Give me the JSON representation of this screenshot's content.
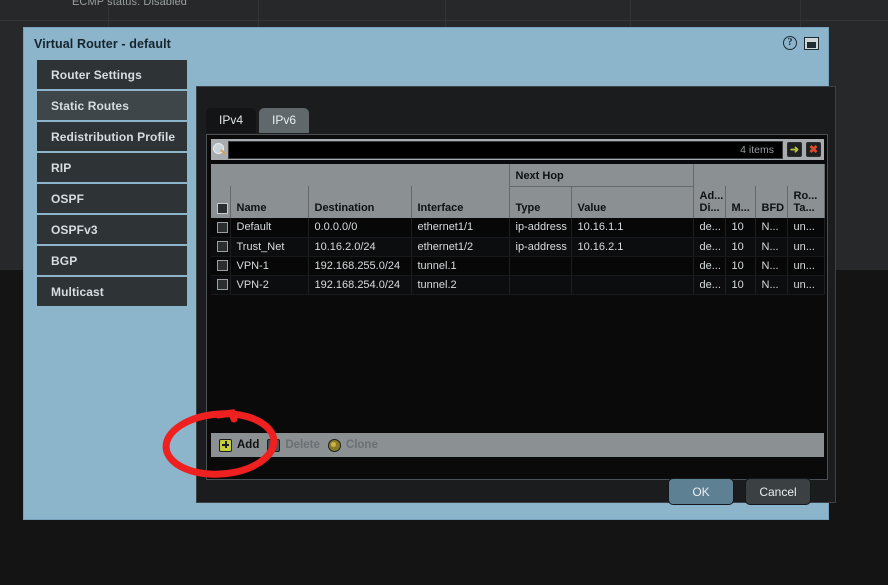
{
  "background": {
    "ecmp_status": "ECMP status: Disabled"
  },
  "dialog": {
    "title": "Virtual Router - default",
    "help_icon": "help-icon",
    "window_icon": "maximize-window-icon"
  },
  "sidebar": {
    "items": [
      {
        "label": "Router Settings",
        "selected": false
      },
      {
        "label": "Static Routes",
        "selected": true
      },
      {
        "label": "Redistribution Profile",
        "selected": false
      },
      {
        "label": "RIP",
        "selected": false
      },
      {
        "label": "OSPF",
        "selected": false
      },
      {
        "label": "OSPFv3",
        "selected": false
      },
      {
        "label": "BGP",
        "selected": false
      },
      {
        "label": "Multicast",
        "selected": false
      }
    ]
  },
  "tabs": [
    {
      "label": "IPv4",
      "active": true
    },
    {
      "label": "IPv6",
      "active": false
    }
  ],
  "search": {
    "value": "",
    "placeholder": "",
    "items_count": "4 items",
    "search_icon": "magnifier-icon",
    "apply_icon": "arrow-right-icon",
    "clear_icon": "close-x-icon"
  },
  "table": {
    "group_header": "Next Hop",
    "columns": [
      "Name",
      "Destination",
      "Interface",
      "Type",
      "Value",
      "Ad... Di...",
      "M...",
      "BFD",
      "Ro... Ta..."
    ],
    "columns_wrapped": {
      "admin_distance": [
        "Ad...",
        "Di..."
      ],
      "metric": [
        "M..."
      ],
      "bfd": [
        "BFD"
      ],
      "route_table": [
        "Ro...",
        "Ta..."
      ]
    },
    "rows": [
      {
        "name": "Default",
        "destination": "0.0.0.0/0",
        "interface": "ethernet1/1",
        "nexthop_type": "ip-address",
        "nexthop_value": "10.16.1.1",
        "admin_distance": "de...",
        "metric": "10",
        "bfd": "N...",
        "route_table": "un..."
      },
      {
        "name": "Trust_Net",
        "destination": "10.16.2.0/24",
        "interface": "ethernet1/2",
        "nexthop_type": "ip-address",
        "nexthop_value": "10.16.2.1",
        "admin_distance": "de...",
        "metric": "10",
        "bfd": "N...",
        "route_table": "un..."
      },
      {
        "name": "VPN-1",
        "destination": "192.168.255.0/24",
        "interface": "tunnel.1",
        "nexthop_type": "",
        "nexthop_value": "",
        "admin_distance": "de...",
        "metric": "10",
        "bfd": "N...",
        "route_table": "un..."
      },
      {
        "name": "VPN-2",
        "destination": "192.168.254.0/24",
        "interface": "tunnel.2",
        "nexthop_type": "",
        "nexthop_value": "",
        "admin_distance": "de...",
        "metric": "10",
        "bfd": "N...",
        "route_table": "un..."
      }
    ]
  },
  "actions": {
    "add": "Add",
    "delete": "Delete",
    "clone": "Clone"
  },
  "footer": {
    "ok": "OK",
    "cancel": "Cancel"
  },
  "annotation": {
    "shape": "red-ellipse-highlight",
    "target": "Add",
    "color": "#ee2020"
  },
  "colors": {
    "dialog_chrome": "#8cb4cb",
    "ok_button": "#5d8093",
    "annotation_red": "#ee2020",
    "header_gray": "#8b9093",
    "panel_dark": "#1b1c1d"
  }
}
